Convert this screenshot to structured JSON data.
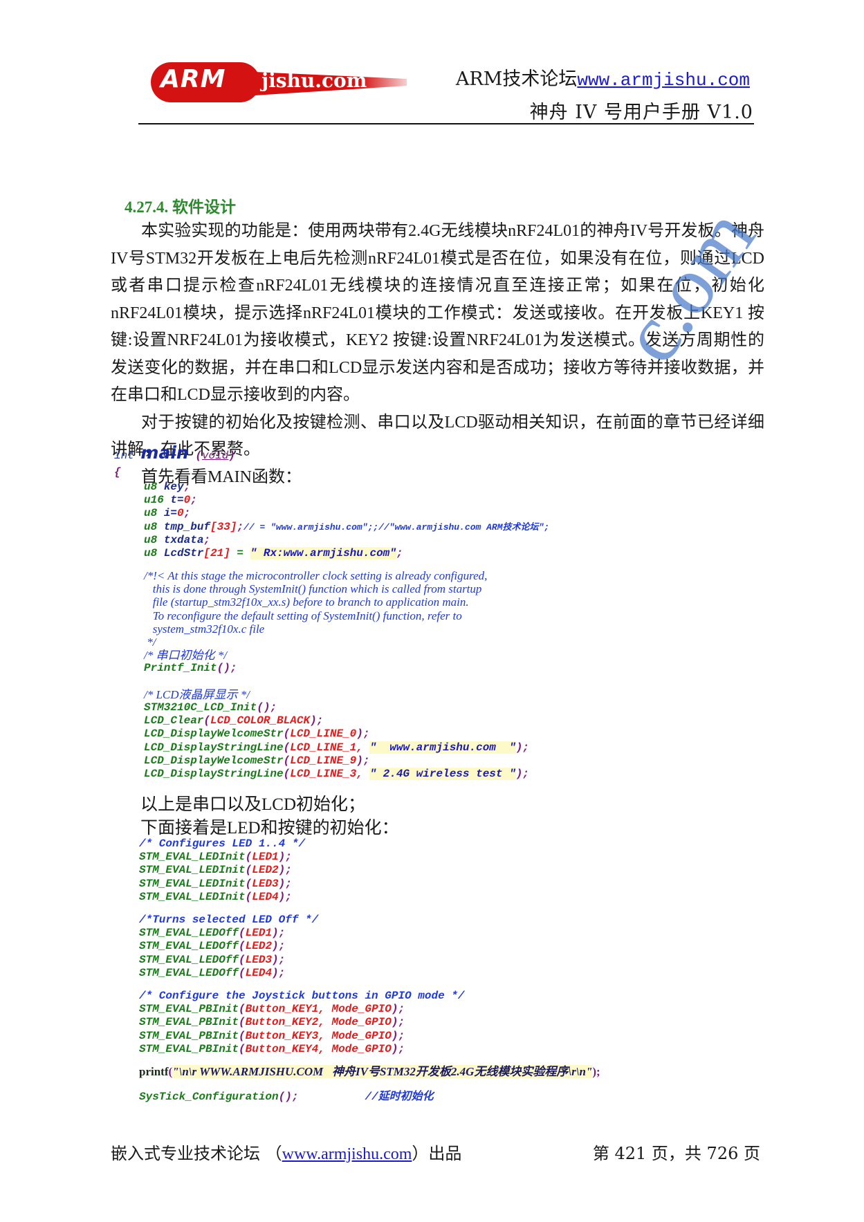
{
  "header": {
    "logo_arm": "ARM",
    "logo_site": "jishu.com",
    "forum_name": "ARM技术论坛",
    "forum_url": "www.armjishu.com",
    "manual_title": "神舟 IV 号用户手册 V1.0"
  },
  "section": {
    "title": "4.27.4. 软件设计",
    "paragraphs": [
      "本实验实现的功能是：使用两块带有2.4G无线模块nRF24L01的神舟IV号开发板。神舟IV号STM32开发板在上电后先检测nRF24L01模式是否在位，如果没有在位，则通过LCD或者串口提示检查nRF24L01无线模块的连接情况直至连接正常；如果在位，初始化nRF24L01模块，提示选择nRF24L01模块的工作模式：发送或接收。在开发板上KEY1 按键:设置NRF24L01为接收模式，KEY2 按键:设置NRF24L01为发送模式。发送方周期性的发送变化的数据，并在串口和LCD显示发送内容和是否成功；接收方等待并接收数据，并在串口和LCD显示接收到的内容。",
      "对于按键的初始化及按键检测、串口以及LCD驱动相关知识，在前面的章节已经详细讲解，在此不累赘。",
      "首先看看MAIN函数："
    ]
  },
  "code1": {
    "signature": {
      "type": "int",
      "name": "main",
      "params": "void"
    },
    "open_brace": "{",
    "decls": [
      {
        "type": "u8",
        "rest": "key",
        "end": ";"
      },
      {
        "type": "u16",
        "rest": "t=",
        "val": "0",
        "end": ";"
      },
      {
        "type": "u8",
        "rest": "i=",
        "val": "0",
        "end": ";"
      },
      {
        "type": "u8",
        "rest": "tmp_buf",
        "idx": "[33]",
        "end": ";",
        "comment": "// = \"www.armjishu.com\";;//\"www.armjishu.com ARM技术论坛\";"
      },
      {
        "type": "u8",
        "rest": "txdata",
        "end": ";"
      },
      {
        "type": "u8",
        "rest": "LcdStr",
        "idx": "[21]",
        "eq": " = ",
        "str": "\" Rx:www.armjishu.com\"",
        "end": ";"
      }
    ],
    "block_comment": [
      "/*!< At this stage the microcontroller clock setting is already configured,",
      "   this is done through SystemInit() function which is called from startup",
      "   file (startup_stm32f10x_xx.s) before to branch to application main.",
      "   To reconfigure the default setting of SystemInit() function, refer to",
      "   system_stm32f10x.c file",
      " */"
    ],
    "uart_comment": "/* 串口初始化 */",
    "uart_call": "Printf_Init",
    "lcd_comment": "/* LCD液晶屏显示 */",
    "lcd_calls": [
      {
        "fn": "STM3210C_LCD_Init",
        "args": ""
      },
      {
        "fn": "LCD_Clear",
        "args": "LCD_COLOR_BLACK"
      },
      {
        "fn": "LCD_DisplayWelcomeStr",
        "args": "LCD_LINE_0"
      },
      {
        "fn": "LCD_DisplayStringLine",
        "args": "LCD_LINE_1, ",
        "str": "\"  www.armjishu.com  \""
      },
      {
        "fn": "LCD_DisplayWelcomeStr",
        "args": "LCD_LINE_9"
      },
      {
        "fn": "LCD_DisplayStringLine",
        "args": "LCD_LINE_3, ",
        "str": "\" 2.4G wireless test \""
      }
    ]
  },
  "mid_text": {
    "line1": "以上是串口以及LCD初始化；",
    "line2": "下面接着是LED和按键的初始化："
  },
  "code2": {
    "led_comment": "/* Configures LED 1..4 */",
    "led_init": [
      {
        "fn": "STM_EVAL_LEDInit",
        "arg": "LED1"
      },
      {
        "fn": "STM_EVAL_LEDInit",
        "arg": "LED2"
      },
      {
        "fn": "STM_EVAL_LEDInit",
        "arg": "LED3"
      },
      {
        "fn": "STM_EVAL_LEDInit",
        "arg": "LED4"
      }
    ],
    "off_comment": "/*Turns selected LED Off */",
    "led_off": [
      {
        "fn": "STM_EVAL_LEDOff",
        "arg": "LED1"
      },
      {
        "fn": "STM_EVAL_LEDOff",
        "arg": "LED2"
      },
      {
        "fn": "STM_EVAL_LEDOff",
        "arg": "LED3"
      },
      {
        "fn": "STM_EVAL_LEDOff",
        "arg": "LED4"
      }
    ],
    "pb_comment": "/* Configure the Joystick buttons in GPIO mode */",
    "pb_init": [
      {
        "fn": "STM_EVAL_PBInit",
        "arg": "Button_KEY1, Mode_GPIO"
      },
      {
        "fn": "STM_EVAL_PBInit",
        "arg": "Button_KEY2, Mode_GPIO"
      },
      {
        "fn": "STM_EVAL_PBInit",
        "arg": "Button_KEY3, Mode_GPIO"
      },
      {
        "fn": "STM_EVAL_PBInit",
        "arg": "Button_KEY4, Mode_GPIO"
      }
    ],
    "printf_fn": "printf",
    "printf_str": "\"\\n\\r WWW.ARMJISHU.COM   神舟IV号STM32开发板2.4G无线模块实验程序\\r\\n\"",
    "systick_fn": "SysTick_Configuration",
    "systick_comment": "//延时初始化"
  },
  "footer": {
    "left_prefix": "嵌入式专业技术论坛 （",
    "left_link": "www.armjishu.com",
    "left_suffix": "）出品",
    "page_info": "第 421 页，共 726 页"
  },
  "watermark": {
    "text": "c.om"
  }
}
